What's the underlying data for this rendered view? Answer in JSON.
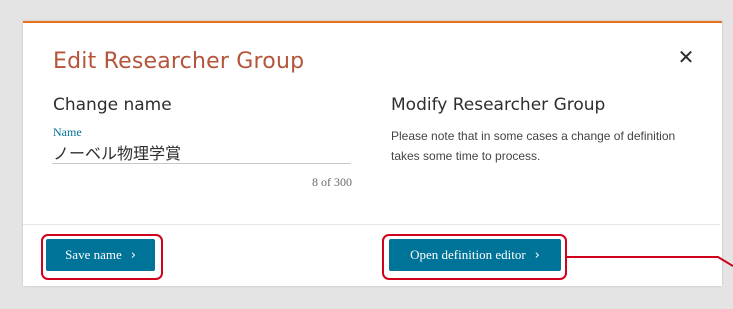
{
  "dialog": {
    "title": "Edit Researcher Group",
    "close_icon": "close-icon"
  },
  "change_name": {
    "heading": "Change name",
    "field_label": "Name",
    "value": "ノーベル物理学賞",
    "char_count": "8 of 300",
    "save_label": "Save name"
  },
  "modify_group": {
    "heading": "Modify Researcher Group",
    "note": "Please note that in some cases a change of definition takes some time to process.",
    "open_label": "Open definition editor"
  },
  "colors": {
    "accent_top_border": "#e9711c",
    "title": "#b4553a",
    "primary_button": "#007398",
    "highlight_annotation": "#d0021b",
    "backdrop": "#e4e4e4"
  }
}
